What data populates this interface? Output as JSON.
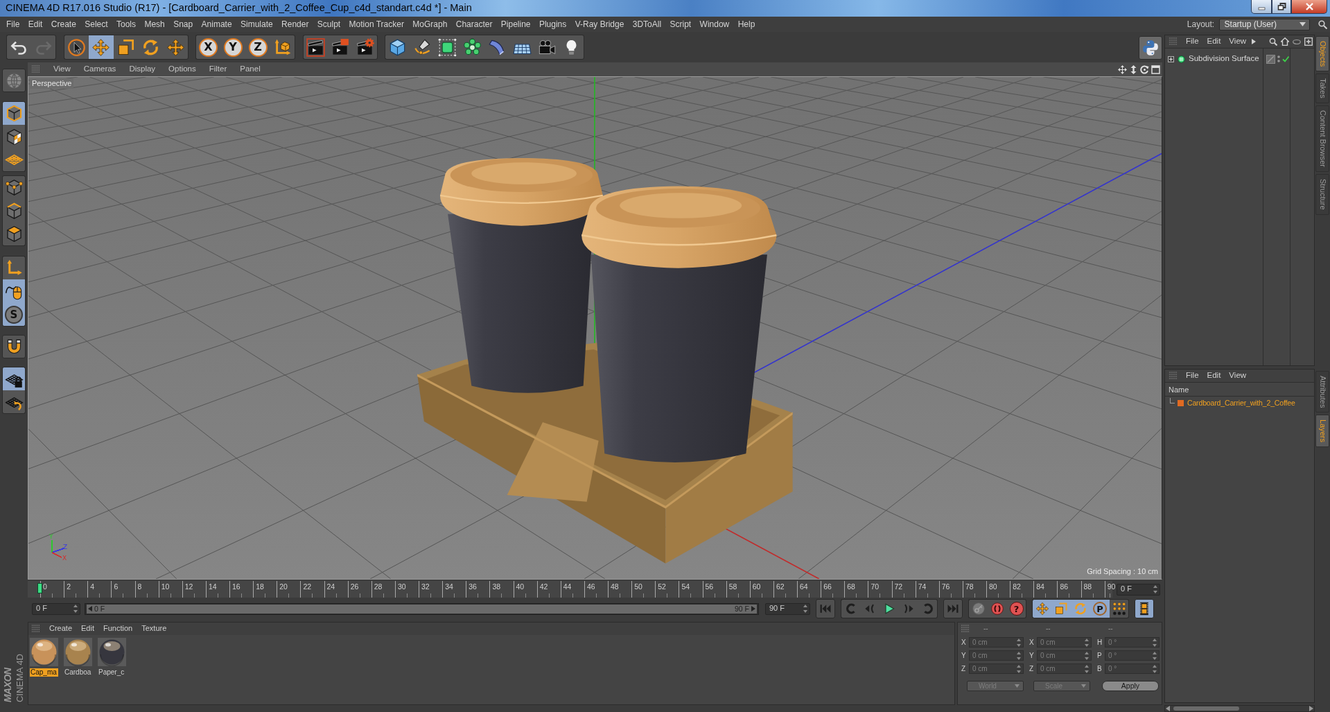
{
  "window": {
    "title": "CINEMA 4D R17.016 Studio (R17) - [Cardboard_Carrier_with_2_Coffee_Cup_c4d_standart.c4d *] - Main"
  },
  "menu_bar": {
    "items": [
      "File",
      "Edit",
      "Create",
      "Select",
      "Tools",
      "Mesh",
      "Snap",
      "Animate",
      "Simulate",
      "Render",
      "Sculpt",
      "Motion Tracker",
      "MoGraph",
      "Character",
      "Pipeline",
      "Plugins",
      "V-Ray Bridge",
      "3DToAll",
      "Script",
      "Window",
      "Help"
    ],
    "layout_label": "Layout:",
    "layout_value": "Startup (User)"
  },
  "toolbar": {
    "history": [
      {
        "kind": "undo",
        "disabled": false
      },
      {
        "kind": "redo",
        "disabled": true
      }
    ],
    "tools": [
      {
        "kind": "select",
        "selected": false
      },
      {
        "kind": "move",
        "selected": true
      },
      {
        "kind": "scale",
        "selected": false
      },
      {
        "kind": "rotate",
        "selected": false
      },
      {
        "kind": "transform",
        "selected": false
      }
    ],
    "axes": [
      {
        "label": "X"
      },
      {
        "label": "Y"
      },
      {
        "label": "Z"
      }
    ]
  },
  "left_toolbar": [
    {
      "kind": "globe",
      "selected": false
    },
    {
      "kind": "model",
      "selected": true
    },
    {
      "kind": "texture",
      "selected": false
    },
    {
      "kind": "workplane",
      "selected": false
    },
    {
      "kind": "points",
      "selected": false
    },
    {
      "kind": "edges",
      "selected": false
    },
    {
      "kind": "polygons",
      "selected": false
    },
    {
      "kind": "axis",
      "selected": false
    },
    {
      "kind": "tweak",
      "selected": true
    },
    {
      "kind": "snap",
      "selected": true,
      "label": "S"
    },
    {
      "kind": "magnet",
      "selected": false
    },
    {
      "kind": "grid-lock",
      "selected": true
    },
    {
      "kind": "grid-rotate",
      "selected": false
    }
  ],
  "viewport": {
    "menu": [
      "View",
      "Cameras",
      "Display",
      "Options",
      "Filter",
      "Panel"
    ],
    "camera": "Perspective",
    "gizmo_axes": [
      {
        "label": "Y",
        "color": "#2ec82e"
      },
      {
        "label": "Z",
        "color": "#3a3ae0"
      },
      {
        "label": "X",
        "color": "#d03030"
      }
    ],
    "grid_spacing": "Grid Spacing : 10 cm"
  },
  "timeline": {
    "ruler": [
      "0",
      "2",
      "4",
      "6",
      "8",
      "10",
      "12",
      "14",
      "16",
      "18",
      "20",
      "22",
      "24",
      "26",
      "28",
      "30",
      "32",
      "34",
      "36",
      "38",
      "40",
      "42",
      "44",
      "46",
      "48",
      "50",
      "52",
      "54",
      "56",
      "58",
      "60",
      "62",
      "64",
      "66",
      "68",
      "70",
      "72",
      "74",
      "76",
      "78",
      "80",
      "82",
      "84",
      "86",
      "88",
      "90"
    ],
    "playhead": {
      "level": 0
    },
    "current_frame": "0 F"
  },
  "transport": {
    "start_frame": "0 F",
    "range_bar": {
      "level": 1
    },
    "range_start": "0 F",
    "range_end": "90 F",
    "end_frame": "90 F",
    "keys": [
      {
        "kind": "key-lock",
        "selected": false
      },
      {
        "kind": "record",
        "selected": false
      },
      {
        "kind": "autokey",
        "selected": false,
        "label": "?"
      },
      {
        "kind": "position",
        "selected": true
      },
      {
        "kind": "scale",
        "selected": true
      },
      {
        "kind": "rotation",
        "selected": true
      },
      {
        "kind": "parameter",
        "selected": true,
        "label": "P"
      },
      {
        "kind": "point-level",
        "selected": false
      },
      {
        "kind": "timeline",
        "selected": true
      }
    ]
  },
  "materials": {
    "menu": [
      "Create",
      "Edit",
      "Function",
      "Texture"
    ],
    "items": [
      {
        "name": "Cap_ma",
        "selected": true,
        "color": "#c8925a"
      },
      {
        "name": "Cardboa",
        "selected": false,
        "color": "#a8834e"
      },
      {
        "name": "Paper_c",
        "selected": false,
        "color": "#36363e"
      }
    ]
  },
  "logo": {
    "brand": "MAXON",
    "product": "CINEMA 4D"
  },
  "coordinates": {
    "disabled": true,
    "headers": [
      "--",
      "--",
      "--"
    ],
    "columns": [
      {
        "fields": [
          {
            "axis": "X",
            "value": "0 cm"
          },
          {
            "axis": "Y",
            "value": "0 cm"
          },
          {
            "axis": "Z",
            "value": "0 cm"
          }
        ]
      },
      {
        "fields": [
          {
            "axis": "X",
            "value": "0 cm"
          },
          {
            "axis": "Y",
            "value": "0 cm"
          },
          {
            "axis": "Z",
            "value": "0 cm"
          }
        ]
      },
      {
        "fields": [
          {
            "axis": "H",
            "value": "0 °"
          },
          {
            "axis": "P",
            "value": "0 °"
          },
          {
            "axis": "B",
            "value": "0 °"
          }
        ]
      }
    ],
    "dropdowns": [
      "World",
      "Scale"
    ],
    "apply": "Apply"
  },
  "objects": {
    "menu": [
      "File",
      "Edit",
      "View"
    ],
    "items": [
      {
        "name": "Subdivision Surface",
        "expanded": false,
        "enabled": true
      }
    ]
  },
  "layers": {
    "menu": [
      "File",
      "Edit",
      "View"
    ],
    "column": "Name",
    "items": [
      {
        "name": "Cardboard_Carrier_with_2_Coffee",
        "color": "#e06a22",
        "selected": true
      }
    ]
  },
  "side_tabs": {
    "upper": [
      {
        "label": "Objects",
        "selected": true
      },
      {
        "label": "Takes",
        "selected": false
      },
      {
        "label": "Content Browser",
        "selected": false
      },
      {
        "label": "Structure",
        "selected": false
      }
    ],
    "lower": [
      {
        "label": "Attributes",
        "selected": false
      },
      {
        "label": "Layers",
        "selected": true
      }
    ]
  }
}
